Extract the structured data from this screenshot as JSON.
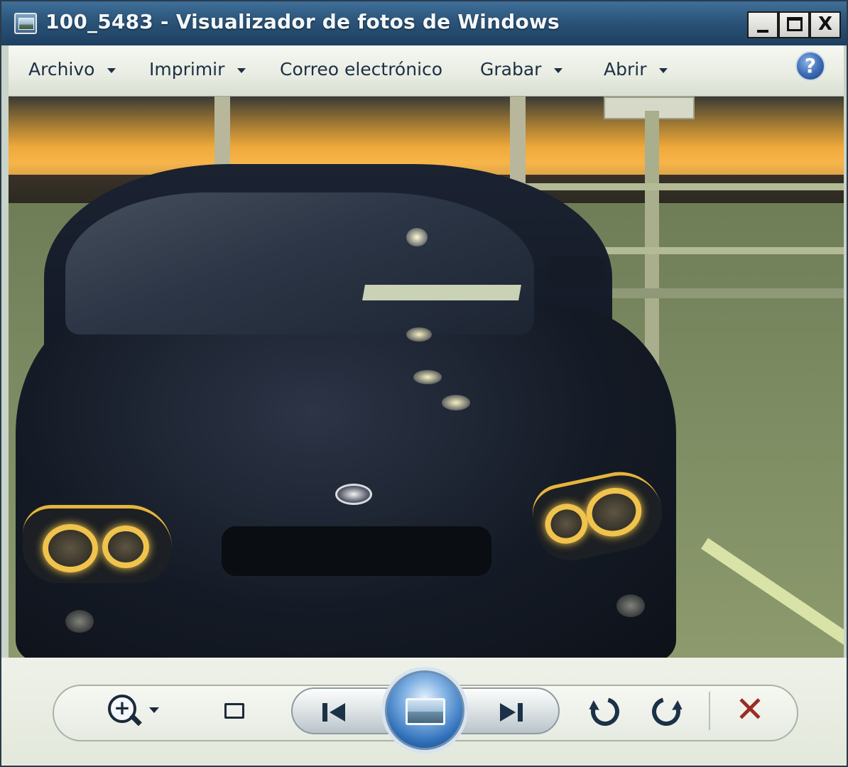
{
  "window": {
    "title": "100_5483 - Visualizador de fotos de Windows",
    "controls": {
      "minimize_icon": "minimize-icon",
      "maximize_icon": "maximize-icon",
      "close_glyph": "X"
    }
  },
  "menu": {
    "items": [
      {
        "label": "Archivo",
        "has_dropdown": true
      },
      {
        "label": "Imprimir",
        "has_dropdown": true
      },
      {
        "label": "Correo electrónico",
        "has_dropdown": false
      },
      {
        "label": "Grabar",
        "has_dropdown": true
      },
      {
        "label": "Abrir",
        "has_dropdown": true
      }
    ],
    "help_glyph": "?"
  },
  "photo": {
    "subject": "car-photo"
  },
  "toolbar": {
    "icons": [
      "zoom-icon",
      "fit-to-window-icon",
      "previous-icon",
      "slideshow-icon",
      "next-icon",
      "rotate-counterclockwise-icon",
      "rotate-clockwise-icon",
      "delete-icon"
    ],
    "zoom_glyph": "+",
    "delete_glyph": "✕",
    "delete_color": "#9b2a25",
    "slideshow_accent": "#2f6fb9"
  }
}
